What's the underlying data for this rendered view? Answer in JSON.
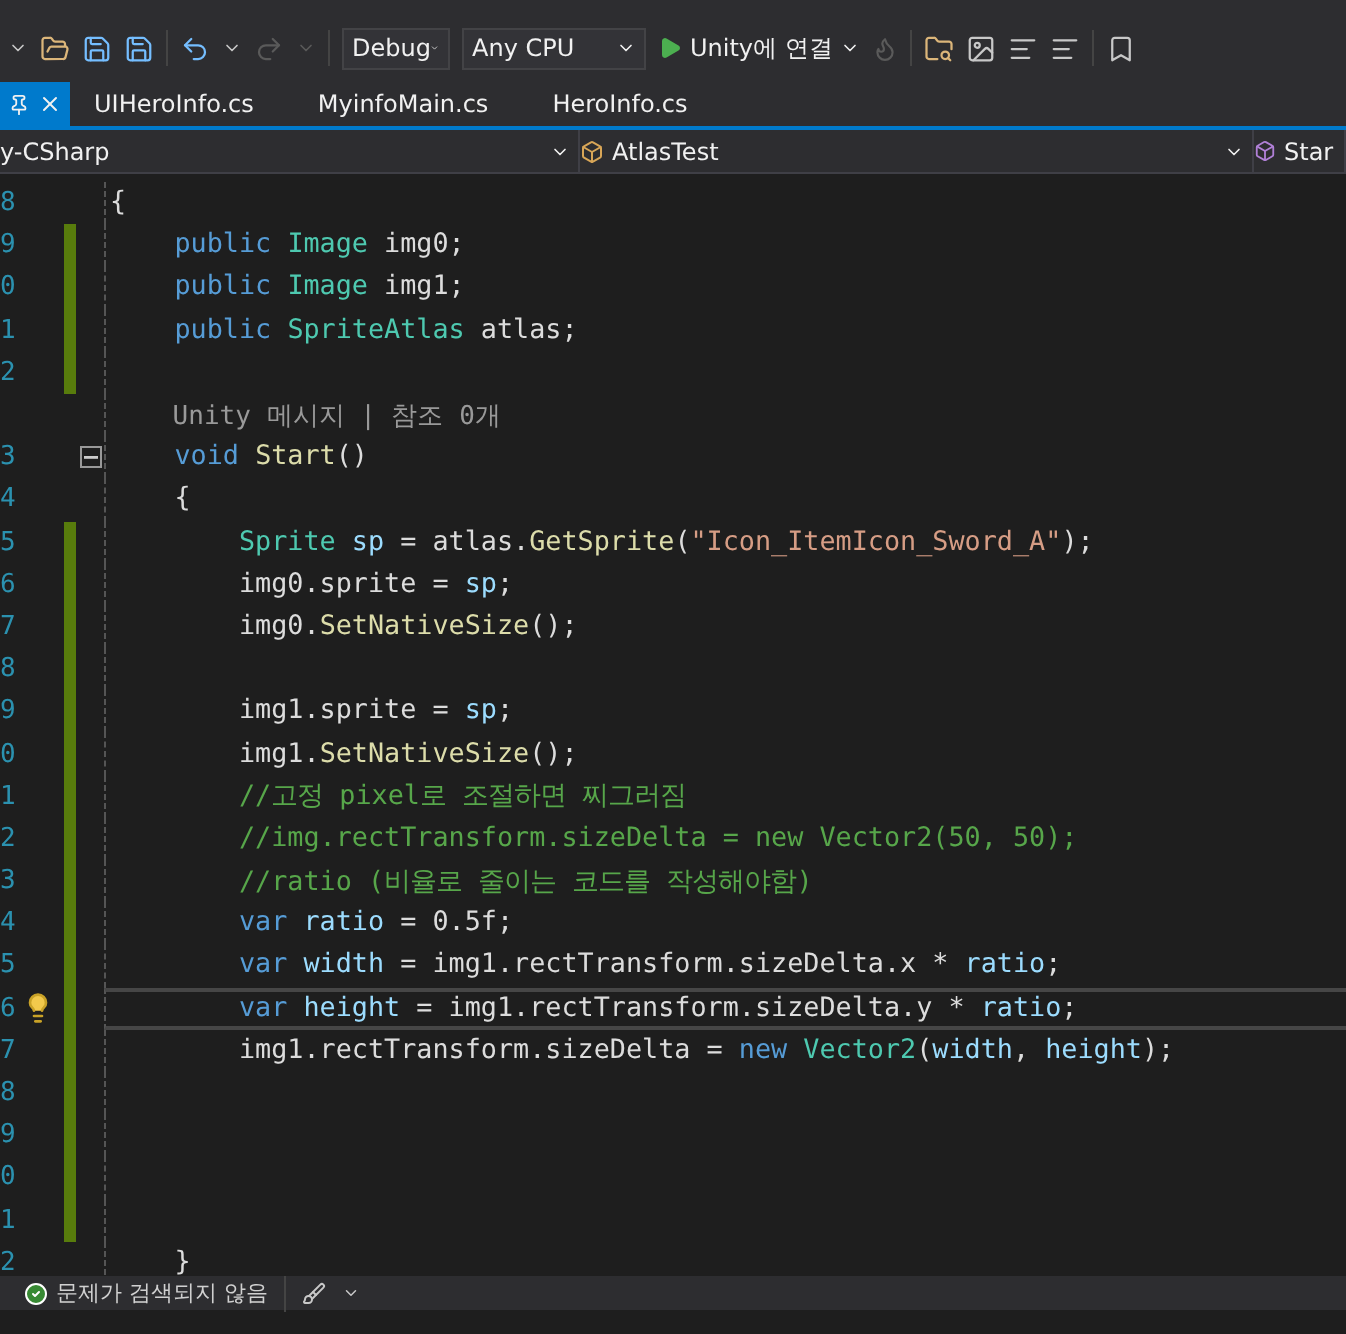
{
  "toolbar": {
    "configuration": "Debug",
    "platform": "Any CPU",
    "run_label": "Unity에 연결",
    "redo_disabled": true
  },
  "tabs": [
    {
      "pinned": true,
      "selected": true
    },
    {
      "label": "UIHeroInfo.cs",
      "pinned": false,
      "selected": false
    },
    {
      "label": "MyinfoMain.cs",
      "pinned": false,
      "selected": false
    },
    {
      "label": "HeroInfo.cs",
      "pinned": false,
      "selected": false
    }
  ],
  "nav_bar": {
    "project": "y-CSharp",
    "class": "AtlasTest",
    "member": "Star"
  },
  "lines": [
    {
      "kind": "code",
      "number": "8",
      "changed": false,
      "tokens": [
        {
          "kind": "plain",
          "text": "{"
        }
      ]
    },
    {
      "kind": "code",
      "number": "9",
      "changed": true,
      "tokens": [
        {
          "kind": "kw",
          "text": "    public "
        },
        {
          "kind": "type",
          "text": "Image"
        },
        {
          "kind": "plain",
          "text": " img0;"
        }
      ]
    },
    {
      "kind": "code",
      "number": "0",
      "changed": true,
      "tokens": [
        {
          "kind": "kw",
          "text": "    public "
        },
        {
          "kind": "type",
          "text": "Image"
        },
        {
          "kind": "plain",
          "text": " img1;"
        }
      ]
    },
    {
      "kind": "code",
      "number": "1",
      "changed": true,
      "tokens": [
        {
          "kind": "kw",
          "text": "    public "
        },
        {
          "kind": "type",
          "text": "SpriteAtlas"
        },
        {
          "kind": "plain",
          "text": " atlas;"
        }
      ]
    },
    {
      "kind": "code",
      "number": "2",
      "changed": true
    },
    {
      "kind": "codelens",
      "text": "    Unity 메시지 | 참조 0개"
    },
    {
      "kind": "code",
      "number": "3",
      "changed": false,
      "fold": true,
      "tokens": [
        {
          "kind": "kw",
          "text": "    void "
        },
        {
          "kind": "method",
          "text": "Start"
        },
        {
          "kind": "plain",
          "text": "()"
        }
      ]
    },
    {
      "kind": "code",
      "number": "4",
      "changed": false,
      "tokens": [
        {
          "kind": "plain",
          "text": "    {"
        }
      ]
    },
    {
      "kind": "code",
      "number": "5",
      "changed": true,
      "tokens": [
        {
          "kind": "type",
          "text": "        Sprite"
        },
        {
          "kind": "var",
          "text": " sp"
        },
        {
          "kind": "plain",
          "text": " = atlas."
        },
        {
          "kind": "method",
          "text": "GetSprite"
        },
        {
          "kind": "plain",
          "text": "("
        },
        {
          "kind": "string",
          "text": "\"Icon_ItemIcon_Sword_A\""
        },
        {
          "kind": "plain",
          "text": ");"
        }
      ]
    },
    {
      "kind": "code",
      "number": "6",
      "changed": true,
      "tokens": [
        {
          "kind": "plain",
          "text": "        img0.sprite = "
        },
        {
          "kind": "var",
          "text": "sp"
        },
        {
          "kind": "plain",
          "text": ";"
        }
      ]
    },
    {
      "kind": "code",
      "number": "7",
      "changed": true,
      "tokens": [
        {
          "kind": "plain",
          "text": "        img0."
        },
        {
          "kind": "method",
          "text": "SetNativeSize"
        },
        {
          "kind": "plain",
          "text": "();"
        }
      ]
    },
    {
      "kind": "code",
      "number": "8",
      "changed": true
    },
    {
      "kind": "code",
      "number": "9",
      "changed": true,
      "tokens": [
        {
          "kind": "plain",
          "text": "        img1.sprite = "
        },
        {
          "kind": "var",
          "text": "sp"
        },
        {
          "kind": "plain",
          "text": ";"
        }
      ]
    },
    {
      "kind": "code",
      "number": "0",
      "changed": true,
      "tokens": [
        {
          "kind": "plain",
          "text": "        img1."
        },
        {
          "kind": "method",
          "text": "SetNativeSize"
        },
        {
          "kind": "plain",
          "text": "();"
        }
      ]
    },
    {
      "kind": "code",
      "number": "1",
      "changed": true,
      "tokens": [
        {
          "kind": "comment",
          "text": "        //고정 pixel로 조절하면 찌그러짐"
        }
      ]
    },
    {
      "kind": "code",
      "number": "2",
      "changed": true,
      "tokens": [
        {
          "kind": "comment",
          "text": "        //img.rectTransform.sizeDelta = new Vector2(50, 50);"
        }
      ]
    },
    {
      "kind": "code",
      "number": "3",
      "changed": true,
      "tokens": [
        {
          "kind": "comment",
          "text": "        //ratio (비율로 줄이는 코드를 작성해야함)"
        }
      ]
    },
    {
      "kind": "code",
      "number": "4",
      "changed": true,
      "tokens": [
        {
          "kind": "kw",
          "text": "        var"
        },
        {
          "kind": "var",
          "text": " ratio"
        },
        {
          "kind": "plain",
          "text": " = 0.5f;"
        }
      ]
    },
    {
      "kind": "code",
      "number": "5",
      "changed": true,
      "tokens": [
        {
          "kind": "kw",
          "text": "        var"
        },
        {
          "kind": "var",
          "text": " width"
        },
        {
          "kind": "plain",
          "text": " = img1.rectTransform.sizeDelta.x * "
        },
        {
          "kind": "var",
          "text": "ratio"
        },
        {
          "kind": "plain",
          "text": ";"
        }
      ]
    },
    {
      "kind": "code",
      "number": "6",
      "changed": true,
      "current": true,
      "lightbulb": true,
      "tokens": [
        {
          "kind": "kw",
          "text": "        var"
        },
        {
          "kind": "var",
          "text": " height"
        },
        {
          "kind": "plain",
          "text": " = img1.rectTransform.sizeDelta.y * "
        },
        {
          "kind": "var",
          "text": "ratio"
        },
        {
          "kind": "plain",
          "text": ";"
        }
      ]
    },
    {
      "kind": "code",
      "number": "7",
      "changed": true,
      "tokens": [
        {
          "kind": "plain",
          "text": "        img1.rectTransform.sizeDelta = "
        },
        {
          "kind": "kw",
          "text": "new"
        },
        {
          "kind": "type",
          "text": " Vector2"
        },
        {
          "kind": "plain",
          "text": "("
        },
        {
          "kind": "var",
          "text": "width"
        },
        {
          "kind": "plain",
          "text": ", "
        },
        {
          "kind": "var",
          "text": "height"
        },
        {
          "kind": "plain",
          "text": ");"
        }
      ]
    },
    {
      "kind": "code",
      "number": "8",
      "changed": true
    },
    {
      "kind": "code",
      "number": "9",
      "changed": true
    },
    {
      "kind": "code",
      "number": "0",
      "changed": true
    },
    {
      "kind": "code",
      "number": "1",
      "changed": true
    },
    {
      "kind": "code",
      "number": "2",
      "changed": false,
      "tokens": [
        {
          "kind": "plain",
          "text": "    }"
        }
      ]
    }
  ],
  "status_bar": {
    "issues": "문제가 검색되지 않음"
  }
}
